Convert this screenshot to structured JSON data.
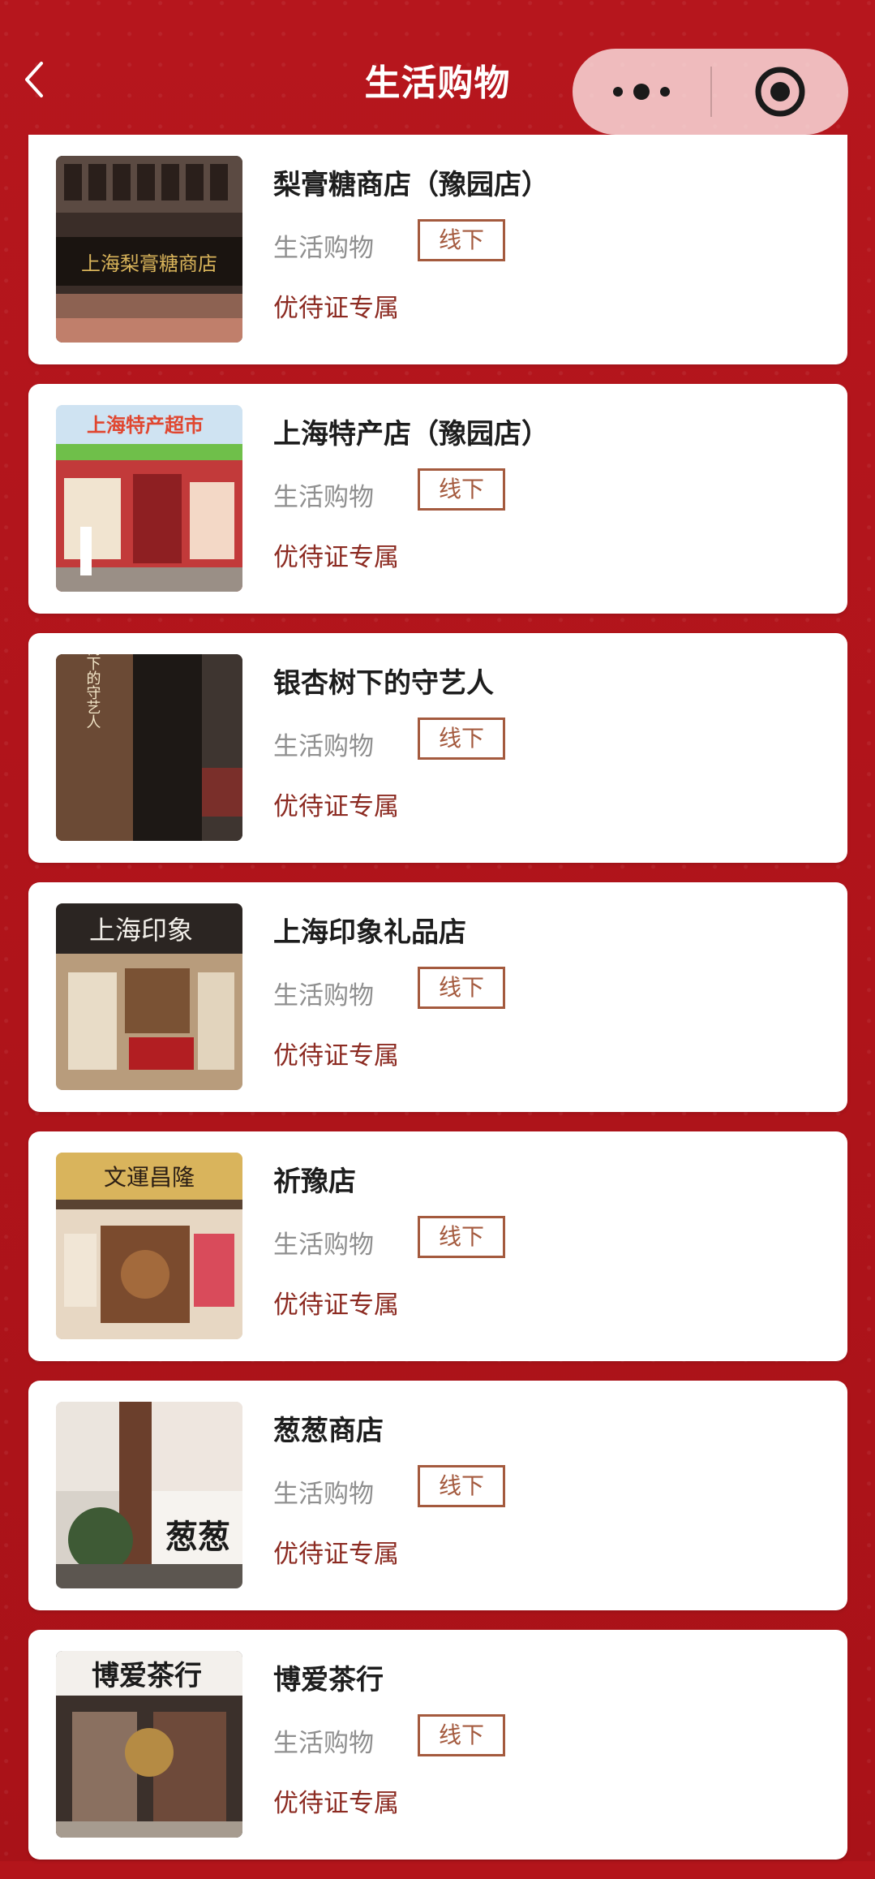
{
  "header": {
    "title": "生活购物",
    "back_icon": "chevron-left-icon",
    "more_icon": "more-dots-icon",
    "target_icon": "target-icon"
  },
  "theme": {
    "background": "#b3151b",
    "card": "#ffffff",
    "tag_color": "#a45a3e",
    "perk_color": "#8c2b22",
    "category_color": "#8f8f8f"
  },
  "stores": [
    {
      "name": "梨膏糖商店（豫园店）",
      "category": "生活购物",
      "tag": "线下",
      "perk": "优待证专属",
      "image_sign": "上海梨膏糖商店"
    },
    {
      "name": "上海特产店（豫园店）",
      "category": "生活购物",
      "tag": "线下",
      "perk": "优待证专属",
      "image_sign": "上海特产超市"
    },
    {
      "name": "银杏树下的守艺人",
      "category": "生活购物",
      "tag": "线下",
      "perk": "优待证专属",
      "image_sign": "银杏树下的守艺人"
    },
    {
      "name": "上海印象礼品店",
      "category": "生活购物",
      "tag": "线下",
      "perk": "优待证专属",
      "image_sign": "上海印象"
    },
    {
      "name": "祈豫店",
      "category": "生活购物",
      "tag": "线下",
      "perk": "优待证专属",
      "image_sign": "文運昌隆"
    },
    {
      "name": "葱葱商店",
      "category": "生活购物",
      "tag": "线下",
      "perk": "优待证专属",
      "image_sign": "葱葱"
    },
    {
      "name": "博爱茶行",
      "category": "生活购物",
      "tag": "线下",
      "perk": "优待证专属",
      "image_sign": "博爱茶行"
    }
  ]
}
